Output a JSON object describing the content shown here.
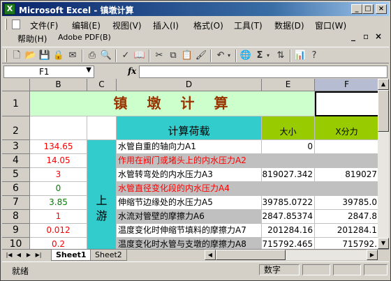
{
  "window": {
    "title": "Microsoft Excel - 镇墩计算",
    "icon_letter": "X",
    "btn_min": "_",
    "btn_max": "□",
    "btn_close": "×"
  },
  "menu": {
    "row1": [
      "文件(F)",
      "编辑(E)",
      "视图(V)",
      "插入(I)",
      "格式(O)",
      "工具(T)",
      "数据(D)",
      "窗口(W)"
    ],
    "row2": [
      "帮助(H)",
      "Adobe PDF(B)"
    ],
    "doc_min": "_",
    "doc_restore": "▫",
    "doc_close": "×"
  },
  "formula_bar": {
    "name_box": "F1",
    "fx": "fx",
    "content": ""
  },
  "columns": [
    "B",
    "C",
    "D",
    "E",
    "F"
  ],
  "rows": [
    "1",
    "2",
    "3",
    "4",
    "5",
    "6",
    "7",
    "8",
    "9",
    "10"
  ],
  "sheet": {
    "title": "镇　墩　计　算",
    "header_load": "计算荷载",
    "header_size": "大小",
    "header_xforce": "X分力",
    "section_label": "上\n游",
    "b_values": [
      "134.65",
      "14.05",
      "3",
      "0",
      "3.85",
      "1",
      "0.012",
      "0.2"
    ],
    "d_labels": [
      "水管自重的轴向力A1",
      "作用在阀门或堵头上的内水压力A2",
      "水管转弯处的内水压力A3",
      "水管直径变化段的内水压力A4",
      "伸缩节边缘处的水压力A5",
      "水流对管壁的摩擦力A6",
      "温度变化时伸缩节填料的摩擦力A7",
      "温度变化时水管与支墩的摩擦力A8"
    ],
    "e_values": [
      "0",
      "",
      "819027.342",
      "",
      "39785.0722",
      "2847.85374",
      "201284.16",
      "715792.465"
    ],
    "f_values": [
      "",
      "",
      "819027",
      "",
      "39785.0",
      "2847.8",
      "201284.1",
      "715792."
    ]
  },
  "tabs": {
    "nav": [
      "|◀",
      "◀",
      "▶",
      "▶|"
    ],
    "sheets": [
      "Sheet1",
      "Sheet2"
    ]
  },
  "status": {
    "left": "就绪",
    "mode": "数字"
  },
  "colors": {
    "title_green": "#ccffcc",
    "teal": "#33cccc",
    "lime": "#99cc00",
    "gray": "#c0c0c0",
    "red_text": "#ff0000",
    "green_text": "#008000",
    "brown_text": "#993300"
  }
}
